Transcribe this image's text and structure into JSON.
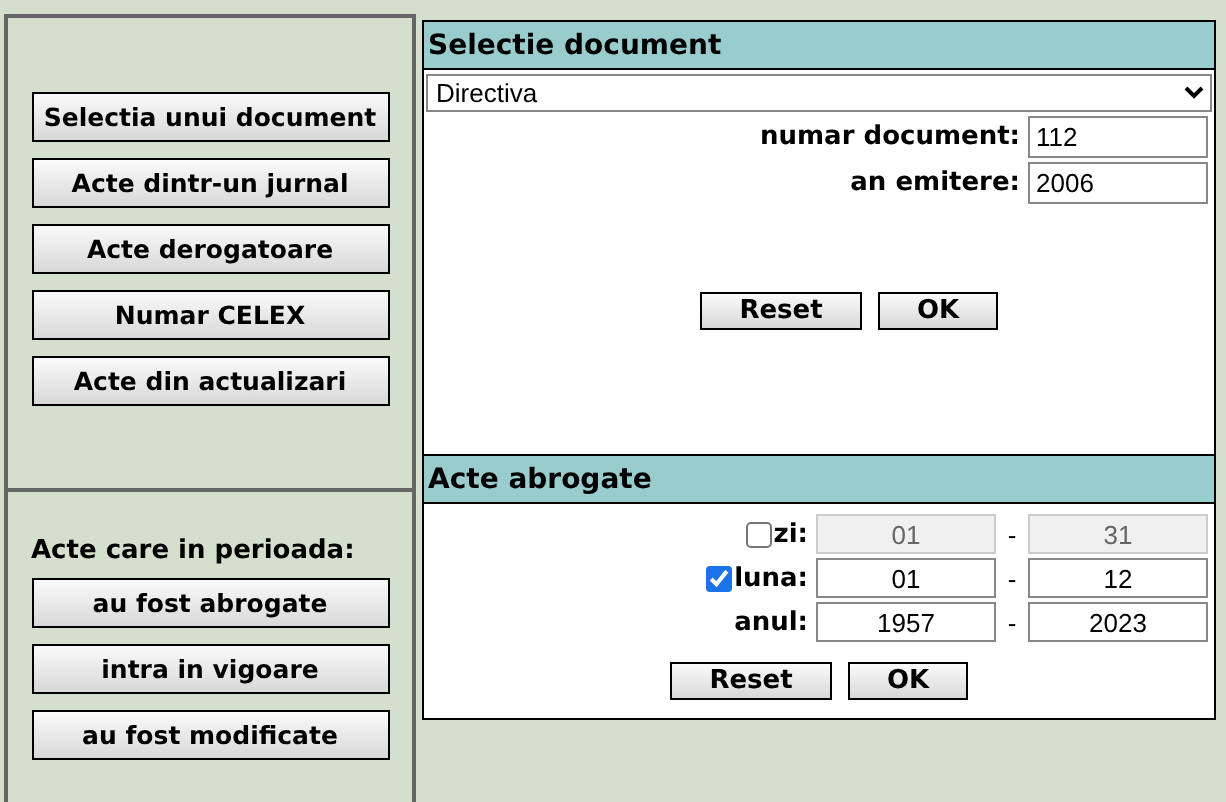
{
  "sidebar": {
    "buttons": [
      "Selectia unui document",
      "Acte dintr-un jurnal",
      "Acte derogatoare",
      "Numar CELEX",
      "Acte din actualizari"
    ],
    "period_label": "Acte care in perioada:",
    "period_buttons": [
      "au fost abrogate",
      "intra in vigoare",
      "au fost modificate"
    ]
  },
  "document_selection": {
    "title": "Selectie document",
    "type_select": {
      "value": "Directiva"
    },
    "fields": [
      {
        "label": "numar document:",
        "value": "112"
      },
      {
        "label": "an emitere:",
        "value": "2006"
      }
    ],
    "buttons": [
      "Reset",
      "OK"
    ]
  },
  "repealed_acts": {
    "title": "Acte abrogate",
    "rows": [
      {
        "kind": "checkbox",
        "label": "zi:",
        "checked": false,
        "disabled": true,
        "from": "01",
        "separator": "-",
        "to": "31"
      },
      {
        "kind": "checkbox",
        "label": "luna:",
        "checked": true,
        "disabled": false,
        "from": "01",
        "separator": "-",
        "to": "12"
      },
      {
        "kind": "plain",
        "label": "anul:",
        "disabled": false,
        "from": "1957",
        "separator": "-",
        "to": "2023"
      }
    ],
    "buttons": [
      "Reset",
      "OK"
    ]
  }
}
